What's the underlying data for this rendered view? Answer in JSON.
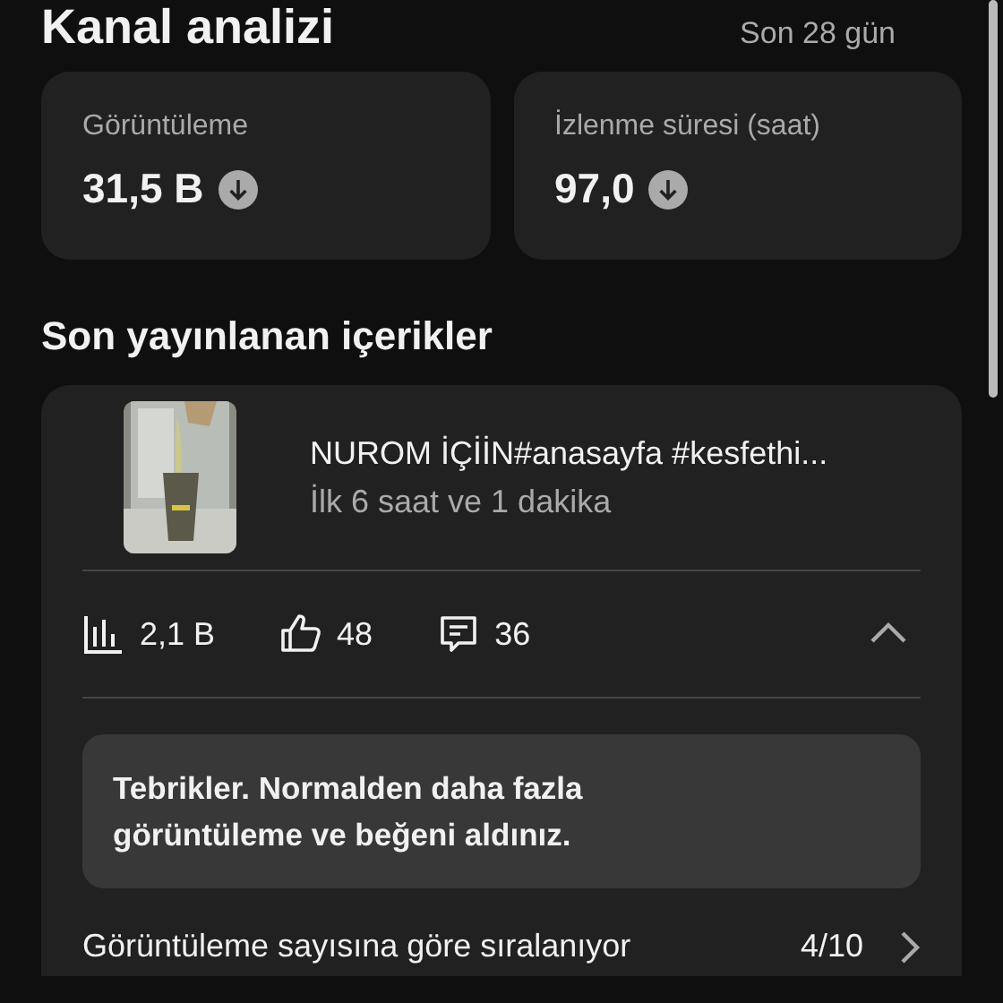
{
  "header": {
    "title": "Kanal analizi",
    "period": "Son 28 gün"
  },
  "metrics": [
    {
      "label": "Görüntüleme",
      "value": "31,5 B",
      "decreased": true
    },
    {
      "label": "İzlenme süresi (saat)",
      "value": "97,0",
      "decreased": true
    }
  ],
  "recent": {
    "title": "Son yayınlanan içerikler",
    "item": {
      "title": "NUROM İÇİİN#anasayfa #kesfethi...",
      "subtitle": "İlk 6 saat ve 1 dakika",
      "expanded": true,
      "stats": [
        {
          "kind": "views",
          "value": "2,1 B"
        },
        {
          "kind": "likes",
          "value": "48"
        },
        {
          "kind": "comments",
          "value": "36"
        }
      ]
    },
    "notice": "Tebrikler. Normalden daha fazla görüntüleme ve beğeni aldınız.",
    "ranking": {
      "label": "Görüntüleme sayısına göre sıralanıyor",
      "position": "4/10"
    }
  }
}
